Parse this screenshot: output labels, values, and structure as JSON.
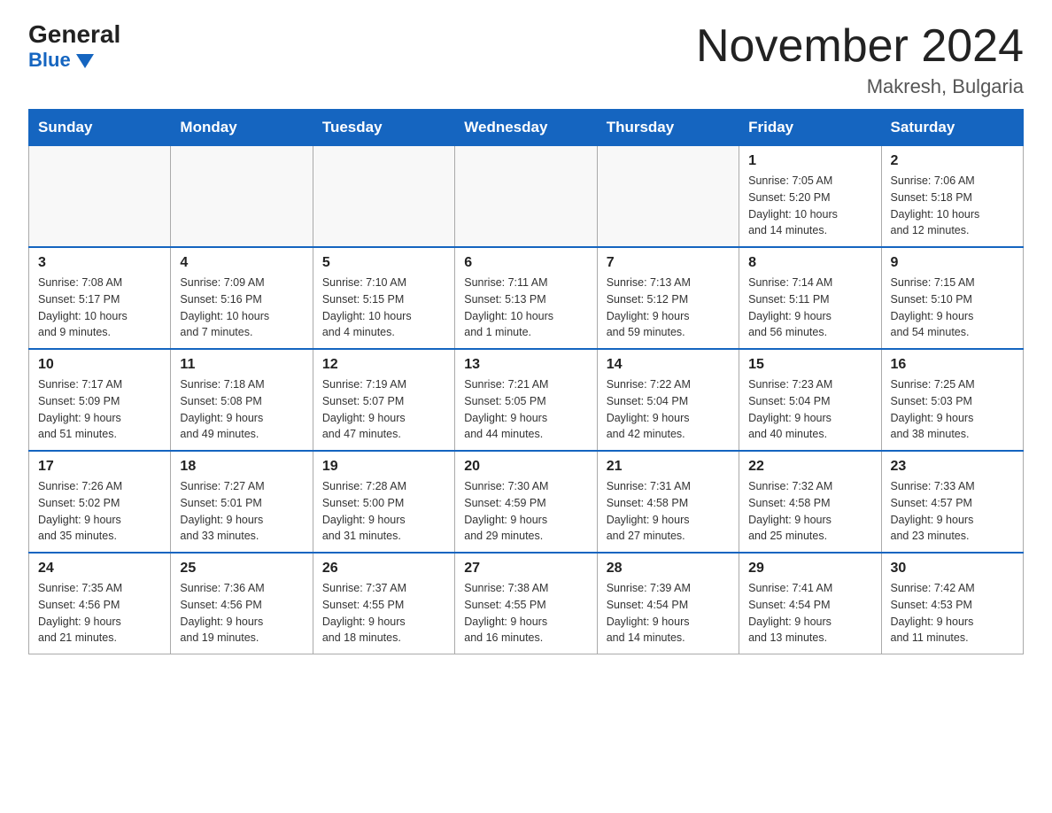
{
  "logo": {
    "general": "General",
    "blue": "Blue"
  },
  "title": "November 2024",
  "subtitle": "Makresh, Bulgaria",
  "days_of_week": [
    "Sunday",
    "Monday",
    "Tuesday",
    "Wednesday",
    "Thursday",
    "Friday",
    "Saturday"
  ],
  "weeks": [
    [
      {
        "num": "",
        "info": ""
      },
      {
        "num": "",
        "info": ""
      },
      {
        "num": "",
        "info": ""
      },
      {
        "num": "",
        "info": ""
      },
      {
        "num": "",
        "info": ""
      },
      {
        "num": "1",
        "info": "Sunrise: 7:05 AM\nSunset: 5:20 PM\nDaylight: 10 hours\nand 14 minutes."
      },
      {
        "num": "2",
        "info": "Sunrise: 7:06 AM\nSunset: 5:18 PM\nDaylight: 10 hours\nand 12 minutes."
      }
    ],
    [
      {
        "num": "3",
        "info": "Sunrise: 7:08 AM\nSunset: 5:17 PM\nDaylight: 10 hours\nand 9 minutes."
      },
      {
        "num": "4",
        "info": "Sunrise: 7:09 AM\nSunset: 5:16 PM\nDaylight: 10 hours\nand 7 minutes."
      },
      {
        "num": "5",
        "info": "Sunrise: 7:10 AM\nSunset: 5:15 PM\nDaylight: 10 hours\nand 4 minutes."
      },
      {
        "num": "6",
        "info": "Sunrise: 7:11 AM\nSunset: 5:13 PM\nDaylight: 10 hours\nand 1 minute."
      },
      {
        "num": "7",
        "info": "Sunrise: 7:13 AM\nSunset: 5:12 PM\nDaylight: 9 hours\nand 59 minutes."
      },
      {
        "num": "8",
        "info": "Sunrise: 7:14 AM\nSunset: 5:11 PM\nDaylight: 9 hours\nand 56 minutes."
      },
      {
        "num": "9",
        "info": "Sunrise: 7:15 AM\nSunset: 5:10 PM\nDaylight: 9 hours\nand 54 minutes."
      }
    ],
    [
      {
        "num": "10",
        "info": "Sunrise: 7:17 AM\nSunset: 5:09 PM\nDaylight: 9 hours\nand 51 minutes."
      },
      {
        "num": "11",
        "info": "Sunrise: 7:18 AM\nSunset: 5:08 PM\nDaylight: 9 hours\nand 49 minutes."
      },
      {
        "num": "12",
        "info": "Sunrise: 7:19 AM\nSunset: 5:07 PM\nDaylight: 9 hours\nand 47 minutes."
      },
      {
        "num": "13",
        "info": "Sunrise: 7:21 AM\nSunset: 5:05 PM\nDaylight: 9 hours\nand 44 minutes."
      },
      {
        "num": "14",
        "info": "Sunrise: 7:22 AM\nSunset: 5:04 PM\nDaylight: 9 hours\nand 42 minutes."
      },
      {
        "num": "15",
        "info": "Sunrise: 7:23 AM\nSunset: 5:04 PM\nDaylight: 9 hours\nand 40 minutes."
      },
      {
        "num": "16",
        "info": "Sunrise: 7:25 AM\nSunset: 5:03 PM\nDaylight: 9 hours\nand 38 minutes."
      }
    ],
    [
      {
        "num": "17",
        "info": "Sunrise: 7:26 AM\nSunset: 5:02 PM\nDaylight: 9 hours\nand 35 minutes."
      },
      {
        "num": "18",
        "info": "Sunrise: 7:27 AM\nSunset: 5:01 PM\nDaylight: 9 hours\nand 33 minutes."
      },
      {
        "num": "19",
        "info": "Sunrise: 7:28 AM\nSunset: 5:00 PM\nDaylight: 9 hours\nand 31 minutes."
      },
      {
        "num": "20",
        "info": "Sunrise: 7:30 AM\nSunset: 4:59 PM\nDaylight: 9 hours\nand 29 minutes."
      },
      {
        "num": "21",
        "info": "Sunrise: 7:31 AM\nSunset: 4:58 PM\nDaylight: 9 hours\nand 27 minutes."
      },
      {
        "num": "22",
        "info": "Sunrise: 7:32 AM\nSunset: 4:58 PM\nDaylight: 9 hours\nand 25 minutes."
      },
      {
        "num": "23",
        "info": "Sunrise: 7:33 AM\nSunset: 4:57 PM\nDaylight: 9 hours\nand 23 minutes."
      }
    ],
    [
      {
        "num": "24",
        "info": "Sunrise: 7:35 AM\nSunset: 4:56 PM\nDaylight: 9 hours\nand 21 minutes."
      },
      {
        "num": "25",
        "info": "Sunrise: 7:36 AM\nSunset: 4:56 PM\nDaylight: 9 hours\nand 19 minutes."
      },
      {
        "num": "26",
        "info": "Sunrise: 7:37 AM\nSunset: 4:55 PM\nDaylight: 9 hours\nand 18 minutes."
      },
      {
        "num": "27",
        "info": "Sunrise: 7:38 AM\nSunset: 4:55 PM\nDaylight: 9 hours\nand 16 minutes."
      },
      {
        "num": "28",
        "info": "Sunrise: 7:39 AM\nSunset: 4:54 PM\nDaylight: 9 hours\nand 14 minutes."
      },
      {
        "num": "29",
        "info": "Sunrise: 7:41 AM\nSunset: 4:54 PM\nDaylight: 9 hours\nand 13 minutes."
      },
      {
        "num": "30",
        "info": "Sunrise: 7:42 AM\nSunset: 4:53 PM\nDaylight: 9 hours\nand 11 minutes."
      }
    ]
  ]
}
